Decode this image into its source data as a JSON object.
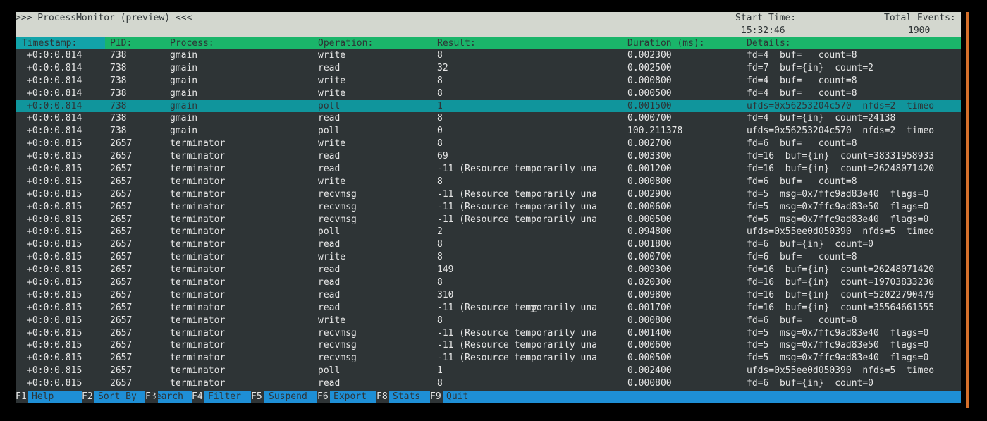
{
  "header": {
    "title": ">>> ProcessMonitor (preview) <<<",
    "start_time_label": "Start Time:",
    "start_time_value": "15:32:46",
    "total_events_label": "Total Events:",
    "total_events_value": "1900"
  },
  "columns": {
    "timestamp": "Timestamp:",
    "pid": "PID:",
    "process": "Process:",
    "operation": "Operation:",
    "result": "Result:",
    "duration": "Duration (ms):",
    "details": "Details:"
  },
  "rows": [
    {
      "ts": "+0:0:0.814",
      "pid": "738",
      "proc": "gmain",
      "op": "write",
      "res": "8",
      "dur": "0.002300",
      "det": "fd=4  buf=   count=8"
    },
    {
      "ts": "+0:0:0.814",
      "pid": "738",
      "proc": "gmain",
      "op": "read",
      "res": "32",
      "dur": "0.002500",
      "det": "fd=7  buf={in}  count=2"
    },
    {
      "ts": "+0:0:0.814",
      "pid": "738",
      "proc": "gmain",
      "op": "write",
      "res": "8",
      "dur": "0.000800",
      "det": "fd=4  buf=   count=8"
    },
    {
      "ts": "+0:0:0.814",
      "pid": "738",
      "proc": "gmain",
      "op": "write",
      "res": "8",
      "dur": "0.000500",
      "det": "fd=4  buf=   count=8"
    },
    {
      "ts": "+0:0:0.814",
      "pid": "738",
      "proc": "gmain",
      "op": "poll",
      "res": "1",
      "dur": "0.001500",
      "det": "ufds=0x56253204c570  nfds=2  timeo",
      "selected": true
    },
    {
      "ts": "+0:0:0.814",
      "pid": "738",
      "proc": "gmain",
      "op": "read",
      "res": "8",
      "dur": "0.000700",
      "det": "fd=4  buf={in}  count=24138"
    },
    {
      "ts": "+0:0:0.814",
      "pid": "738",
      "proc": "gmain",
      "op": "poll",
      "res": "0",
      "dur": "100.211378",
      "det": "ufds=0x56253204c570  nfds=2  timeo"
    },
    {
      "ts": "+0:0:0.815",
      "pid": "2657",
      "proc": "terminator",
      "op": "write",
      "res": "8",
      "dur": "0.002700",
      "det": "fd=6  buf=   count=8"
    },
    {
      "ts": "+0:0:0.815",
      "pid": "2657",
      "proc": "terminator",
      "op": "read",
      "res": "69",
      "dur": "0.003300",
      "det": "fd=16  buf={in}  count=38331958933"
    },
    {
      "ts": "+0:0:0.815",
      "pid": "2657",
      "proc": "terminator",
      "op": "read",
      "res": "-11 (Resource temporarily una",
      "dur": "0.001200",
      "det": "fd=16  buf={in}  count=26248071420"
    },
    {
      "ts": "+0:0:0.815",
      "pid": "2657",
      "proc": "terminator",
      "op": "write",
      "res": "8",
      "dur": "0.000800",
      "det": "fd=6  buf=   count=8"
    },
    {
      "ts": "+0:0:0.815",
      "pid": "2657",
      "proc": "terminator",
      "op": "recvmsg",
      "res": "-11 (Resource temporarily una",
      "dur": "0.002900",
      "det": "fd=5  msg=0x7ffc9ad83e40  flags=0"
    },
    {
      "ts": "+0:0:0.815",
      "pid": "2657",
      "proc": "terminator",
      "op": "recvmsg",
      "res": "-11 (Resource temporarily una",
      "dur": "0.000600",
      "det": "fd=5  msg=0x7ffc9ad83e50  flags=0"
    },
    {
      "ts": "+0:0:0.815",
      "pid": "2657",
      "proc": "terminator",
      "op": "recvmsg",
      "res": "-11 (Resource temporarily una",
      "dur": "0.000500",
      "det": "fd=5  msg=0x7ffc9ad83e40  flags=0"
    },
    {
      "ts": "+0:0:0.815",
      "pid": "2657",
      "proc": "terminator",
      "op": "poll",
      "res": "2",
      "dur": "0.094800",
      "det": "ufds=0x55ee0d050390  nfds=5  timeo"
    },
    {
      "ts": "+0:0:0.815",
      "pid": "2657",
      "proc": "terminator",
      "op": "read",
      "res": "8",
      "dur": "0.001800",
      "det": "fd=6  buf={in}  count=0"
    },
    {
      "ts": "+0:0:0.815",
      "pid": "2657",
      "proc": "terminator",
      "op": "write",
      "res": "8",
      "dur": "0.000700",
      "det": "fd=6  buf=   count=8"
    },
    {
      "ts": "+0:0:0.815",
      "pid": "2657",
      "proc": "terminator",
      "op": "read",
      "res": "149",
      "dur": "0.009300",
      "det": "fd=16  buf={in}  count=26248071420"
    },
    {
      "ts": "+0:0:0.815",
      "pid": "2657",
      "proc": "terminator",
      "op": "read",
      "res": "8",
      "dur": "0.020300",
      "det": "fd=16  buf={in}  count=19703833230"
    },
    {
      "ts": "+0:0:0.815",
      "pid": "2657",
      "proc": "terminator",
      "op": "read",
      "res": "310",
      "dur": "0.009800",
      "det": "fd=16  buf={in}  count=52022790479"
    },
    {
      "ts": "+0:0:0.815",
      "pid": "2657",
      "proc": "terminator",
      "op": "read",
      "res": "-11 (Resource temporarily una",
      "dur": "0.001700",
      "det": "fd=16  buf={in}  count=35564661555"
    },
    {
      "ts": "+0:0:0.815",
      "pid": "2657",
      "proc": "terminator",
      "op": "write",
      "res": "8",
      "dur": "0.000800",
      "det": "fd=6  buf=   count=8"
    },
    {
      "ts": "+0:0:0.815",
      "pid": "2657",
      "proc": "terminator",
      "op": "recvmsg",
      "res": "-11 (Resource temporarily una",
      "dur": "0.001400",
      "det": "fd=5  msg=0x7ffc9ad83e40  flags=0"
    },
    {
      "ts": "+0:0:0.815",
      "pid": "2657",
      "proc": "terminator",
      "op": "recvmsg",
      "res": "-11 (Resource temporarily una",
      "dur": "0.000600",
      "det": "fd=5  msg=0x7ffc9ad83e50  flags=0"
    },
    {
      "ts": "+0:0:0.815",
      "pid": "2657",
      "proc": "terminator",
      "op": "recvmsg",
      "res": "-11 (Resource temporarily una",
      "dur": "0.000500",
      "det": "fd=5  msg=0x7ffc9ad83e40  flags=0"
    },
    {
      "ts": "+0:0:0.815",
      "pid": "2657",
      "proc": "terminator",
      "op": "poll",
      "res": "1",
      "dur": "0.002400",
      "det": "ufds=0x55ee0d050390  nfds=5  timeo"
    },
    {
      "ts": "+0:0:0.815",
      "pid": "2657",
      "proc": "terminator",
      "op": "read",
      "res": "8",
      "dur": "0.000800",
      "det": "fd=6  buf={in}  count=0"
    }
  ],
  "footer": {
    "keys": [
      {
        "key": "F1",
        "label": "Help"
      },
      {
        "key": "F2",
        "label": "Sort By"
      },
      {
        "key": "F3",
        "label": "Search"
      },
      {
        "key": "F4",
        "label": "Filter"
      },
      {
        "key": "F5",
        "label": "Suspend"
      },
      {
        "key": "F6",
        "label": "Export"
      },
      {
        "key": "F8",
        "label": "Stats"
      },
      {
        "key": "F9",
        "label": "Quit"
      }
    ]
  },
  "icons": {
    "mouse_cursor": "text-cursor-icon"
  },
  "colors": {
    "background": "#2e3436",
    "header": "#d3d7cf",
    "column_header": "#1ab56a",
    "selected_row": "#10959c",
    "footer": "#1e8fd6"
  }
}
